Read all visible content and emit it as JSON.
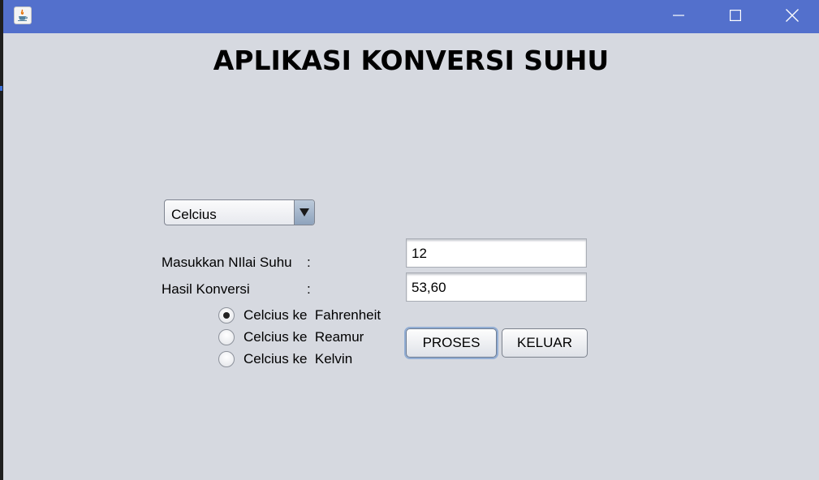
{
  "window": {
    "title": "",
    "controls": {
      "minimize_icon": "minimize-icon",
      "maximize_icon": "maximize-icon",
      "close_icon": "close-icon"
    },
    "titlebar_color": "#5370cc",
    "background_color": "#d6d9e0"
  },
  "heading": "APLIKASI KONVERSI SUHU",
  "unit_select": {
    "selected": "Celcius"
  },
  "form": {
    "input_label": "Masukkan NIlai Suhu",
    "input_colon": ":",
    "input_value": "12",
    "result_label": "Hasil Konversi",
    "result_colon": ":",
    "result_value": "53,60"
  },
  "options": [
    {
      "label": "Celcius ke  Fahrenheit",
      "checked": true
    },
    {
      "label": "Celcius ke  Reamur",
      "checked": false
    },
    {
      "label": "Celcius ke  Kelvin",
      "checked": false
    }
  ],
  "buttons": {
    "process": "PROSES",
    "exit": "KELUAR"
  }
}
